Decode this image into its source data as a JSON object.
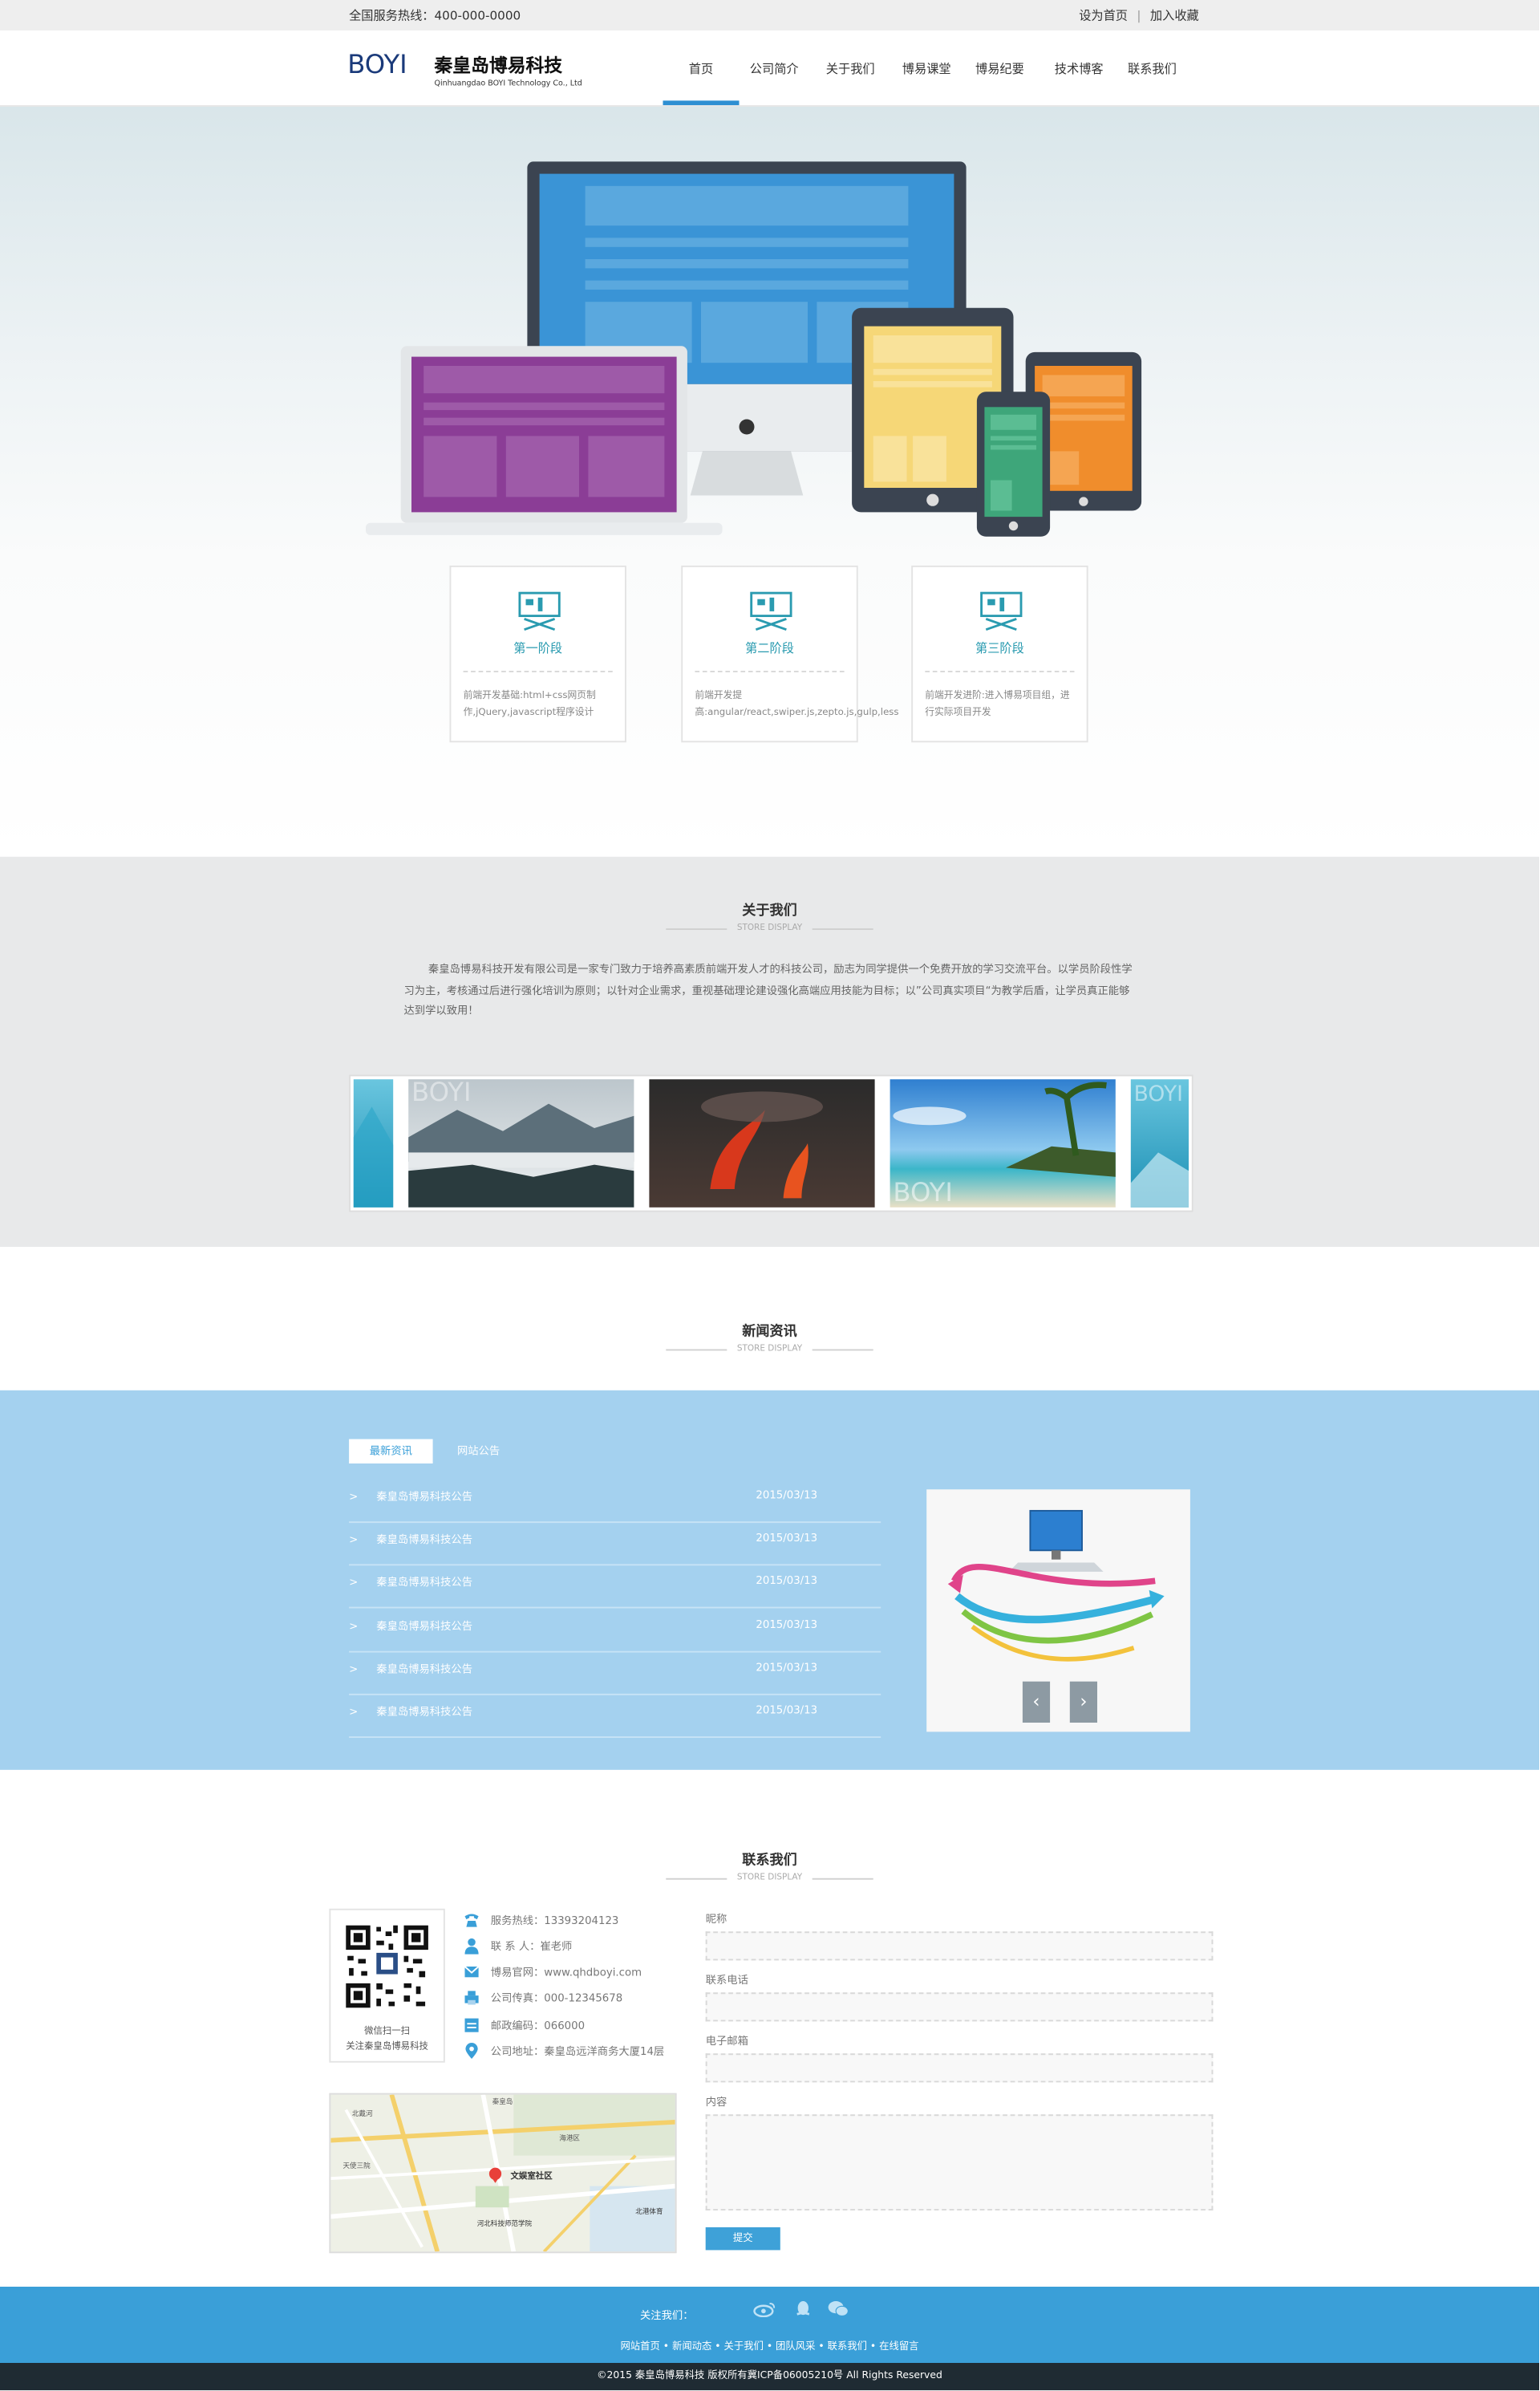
{
  "topbar": {
    "hotline": "全国服务热线：400-000-0000",
    "set_home": "设为首页",
    "separator": "|",
    "bookmark": "加入收藏"
  },
  "brand": {
    "logo_en": "BOYI",
    "name_cn": "秦皇岛博易科技",
    "name_en": "Qinhuangdao BOYI Technology Co., Ltd"
  },
  "nav": {
    "items": [
      {
        "label": "首页",
        "active": true
      },
      {
        "label": "公司简介"
      },
      {
        "label": "关于我们"
      },
      {
        "label": "博易课堂"
      },
      {
        "label": "博易纪要"
      },
      {
        "label": "技术博客"
      },
      {
        "label": "联系我们"
      }
    ]
  },
  "stages": [
    {
      "title": "第一阶段",
      "desc": "前端开发基础:html+css网页制作,jQuery,javascript程序设计"
    },
    {
      "title": "第二阶段",
      "desc": "前端开发提高:angular/react,swiper.js,zepto.js,gulp,less"
    },
    {
      "title": "第三阶段",
      "desc": "前端开发进阶:进入博易项目组，进行实际项目开发"
    }
  ],
  "about": {
    "title": "关于我们",
    "subtitle": "STORE DISPLAY",
    "text": "秦皇岛博易科技开发有限公司是一家专门致力于培养高素质前端开发人才的科技公司，励志为同学提供一个免费开放的学习交流平台。以学员阶段性学习为主，考核通过后进行强化培训为原则；以针对企业需求，重视基础理论建设强化高端应用技能为目标；以”公司真实项目“为教学后盾，让学员真正能够达到学以致用！",
    "gallery_watermark": "BOYI"
  },
  "news": {
    "title": "新闻资讯",
    "subtitle": "STORE DISPLAY",
    "tabs": [
      {
        "label": "最新资讯",
        "active": true
      },
      {
        "label": "网站公告"
      }
    ],
    "arrow": ">",
    "items": [
      {
        "title": "秦皇岛博易科技公告",
        "date": "2015/03/13"
      },
      {
        "title": "秦皇岛博易科技公告",
        "date": "2015/03/13"
      },
      {
        "title": "秦皇岛博易科技公告",
        "date": "2015/03/13"
      },
      {
        "title": "秦皇岛博易科技公告",
        "date": "2015/03/13"
      },
      {
        "title": "秦皇岛博易科技公告",
        "date": "2015/03/13"
      },
      {
        "title": "秦皇岛博易科技公告",
        "date": "2015/03/13"
      }
    ],
    "prev": "‹",
    "next": "›"
  },
  "contact": {
    "title": "联系我们",
    "subtitle": "STORE DISPLAY",
    "qr_line1": "微信扫一扫",
    "qr_line2": "关注秦皇岛博易科技",
    "info": [
      {
        "icon": "phone-icon",
        "text": "服务热线：13393204123"
      },
      {
        "icon": "person-icon",
        "text": "联 系 人：崔老师"
      },
      {
        "icon": "mail-icon",
        "text": "博易官网：www.qhdboyi.com"
      },
      {
        "icon": "fax-icon",
        "text": "公司传真：000-12345678"
      },
      {
        "icon": "postcode-icon",
        "text": "邮政编码：066000"
      },
      {
        "icon": "location-icon",
        "text": "公司地址：秦皇岛远洋商务大厦14层"
      }
    ],
    "form": {
      "nickname_label": "昵称",
      "phone_label": "联系电话",
      "email_label": "电子邮箱",
      "content_label": "内容",
      "submit": "提交"
    },
    "map": {
      "marker": "文娱室社区",
      "labels": [
        "北戴河",
        "河北科技师范学院",
        "秦皇岛",
        "天使三院",
        "海港区",
        "北港体育"
      ]
    }
  },
  "footer": {
    "follow": "关注我们：",
    "links": "网站首页 • 新闻动态 • 关于我们 • 团队风采 • 联系我们 • 在线留言",
    "copyright": "©2015 秦皇岛博易科技  版权所有冀ICP备06005210号 All Rights Reserved"
  },
  "colors": {
    "accent": "#3a9fd8",
    "news_bg": "#a4d1ef",
    "about_bg": "#e8e9ea",
    "stage_title": "#2a9bb0"
  }
}
